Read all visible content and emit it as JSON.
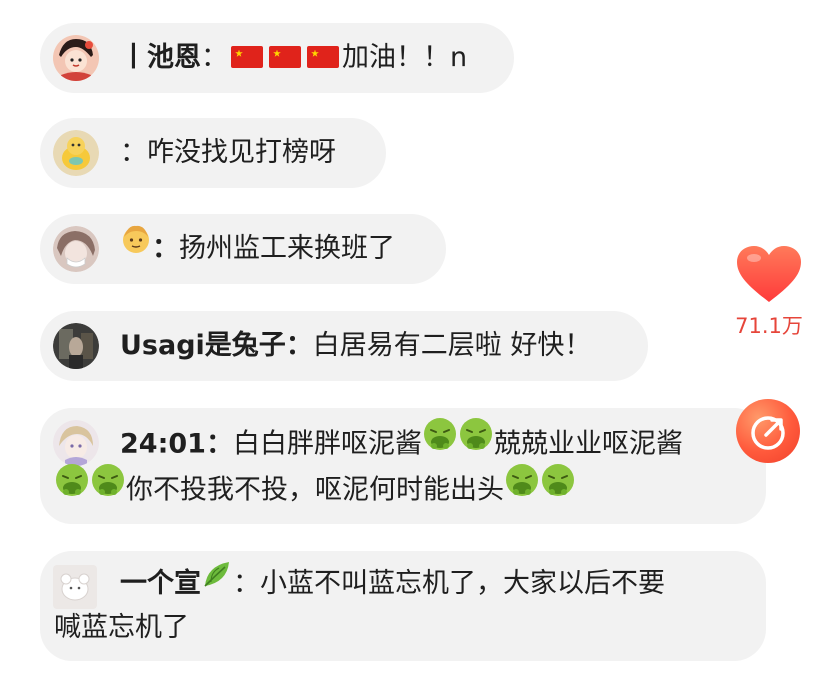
{
  "comments": [
    {
      "name": "丨池恩",
      "sep": "：",
      "text_after_flags": "加油！！n",
      "flag_count": 3
    },
    {
      "name": "",
      "sep": "：",
      "text": "咋没找见打榜呀"
    },
    {
      "name_emoji": "older-person-emoji",
      "sep": "：",
      "text": "扬州监工来换班了"
    },
    {
      "name": "Usagi是兔子",
      "sep": "：",
      "text": "白居易有二层啦 好快！"
    },
    {
      "name": "24:01",
      "sep": "：",
      "line1_a": "白白胖胖呕泥酱",
      "line1_b": "兢兢业业呕泥酱",
      "line2_a": "你不投我不投，呕泥何时能出头"
    },
    {
      "name": "一个宣",
      "name_emoji": "leaf-emoji",
      "sep": "：",
      "line1": "小蓝不叫蓝忘机了，大家以后不要",
      "line2": "喊蓝忘机了"
    }
  ],
  "like": {
    "count": "71.1万",
    "icon": "heart-icon",
    "color": "#ff4a3f"
  },
  "share": {
    "icon": "share-arrow-icon",
    "color": "#ff5a3c"
  }
}
